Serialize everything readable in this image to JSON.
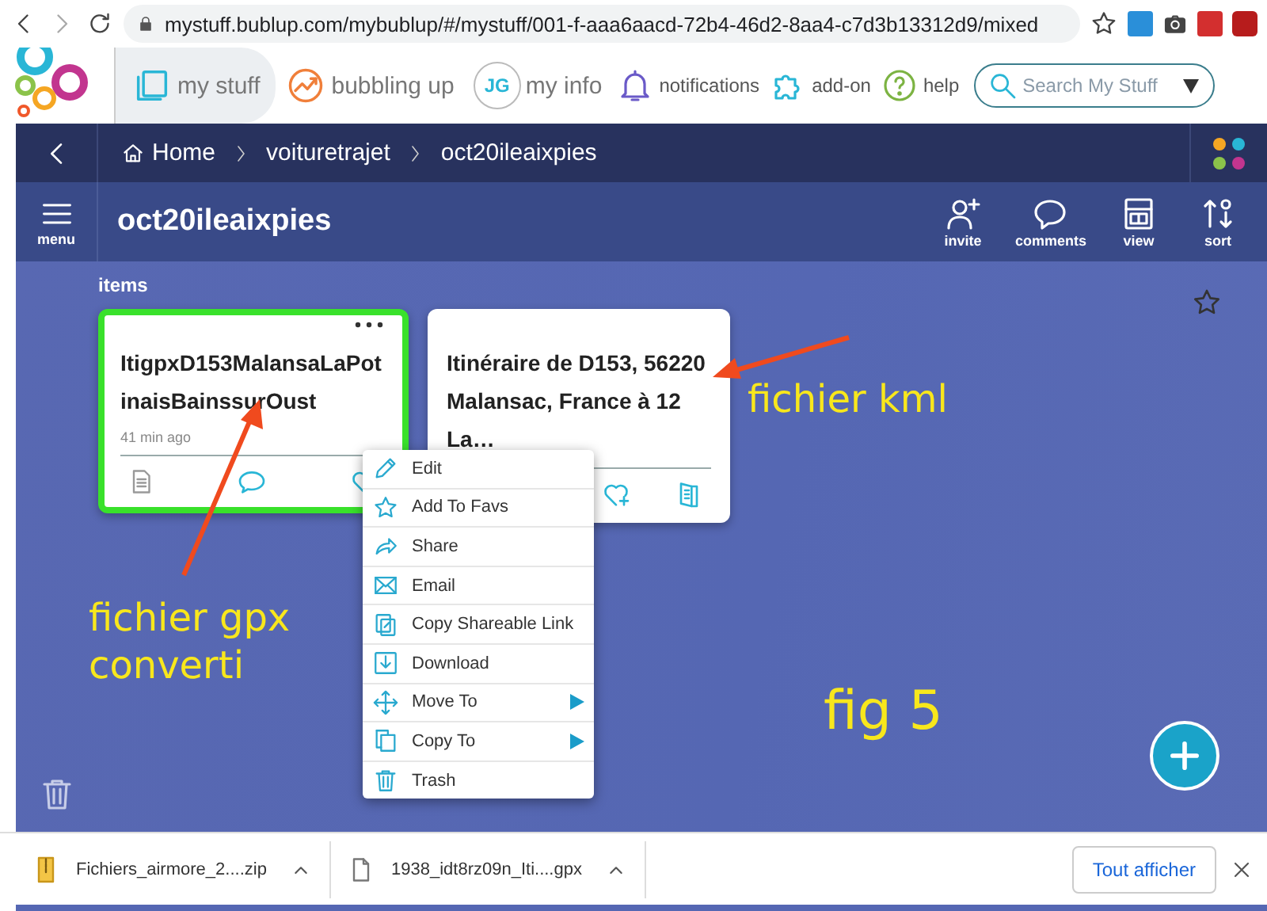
{
  "browser": {
    "url": "mystuff.bublup.com/mybublup/#/mystuff/001-f-aaa6aacd-72b4-46d2-8aa4-c7d3b13312d9/mixed"
  },
  "nav": {
    "tabs": [
      {
        "label": "my stuff",
        "kind": "stuff",
        "selected": true
      },
      {
        "label": "bubbling up",
        "kind": "bubbling",
        "selected": false
      },
      {
        "label": "my info",
        "kind": "info",
        "initials": "JG",
        "selected": false
      },
      {
        "label": "notifications",
        "kind": "bell",
        "selected": false
      },
      {
        "label": "add-on",
        "kind": "puzzle",
        "selected": false
      },
      {
        "label": "help",
        "kind": "help",
        "selected": false
      }
    ],
    "search": {
      "placeholder": "Search My Stuff"
    }
  },
  "breadcrumb": [
    "Home",
    "voituretrajet",
    "oct20ileaixpies"
  ],
  "toolbar": {
    "menu_label": "menu",
    "title": "oct20ileaixpies",
    "actions": [
      {
        "label": "invite",
        "kind": "invite"
      },
      {
        "label": "comments",
        "kind": "comments"
      },
      {
        "label": "view",
        "kind": "view"
      },
      {
        "label": "sort",
        "kind": "sort"
      }
    ]
  },
  "section_label": "items",
  "cards": [
    {
      "title": "ItigpxD153MalansaLaPotinaisBainssurOust",
      "meta": "41 min ago",
      "selected": true
    },
    {
      "title": "Itinéraire de D153, 56220 Malansac, France à 12 La…",
      "selected": false
    }
  ],
  "context_menu": [
    {
      "label": "Edit",
      "kind": "edit",
      "submenu": false
    },
    {
      "label": "Add To Favs",
      "kind": "star",
      "submenu": false
    },
    {
      "label": "Share",
      "kind": "share",
      "submenu": false
    },
    {
      "label": "Email",
      "kind": "email",
      "submenu": false
    },
    {
      "label": "Copy Shareable Link",
      "kind": "link",
      "submenu": false
    },
    {
      "label": "Download",
      "kind": "download",
      "submenu": false
    },
    {
      "label": "Move To",
      "kind": "move",
      "submenu": true
    },
    {
      "label": "Copy To",
      "kind": "copy",
      "submenu": true
    },
    {
      "label": "Trash",
      "kind": "trash",
      "submenu": false
    }
  ],
  "annotations": [
    {
      "text": "fichier kml",
      "kind": "kml"
    },
    {
      "text": "fichier gpx\nconverti",
      "kind": "gpx"
    },
    {
      "text": "fig 5",
      "kind": "fig"
    }
  ],
  "downloads": {
    "files": [
      {
        "name": "Fichiers_airmore_2....zip",
        "kind": "zip"
      },
      {
        "name": "1938_idt8rz09n_Iti....gpx",
        "kind": "file"
      }
    ],
    "show_all": "Tout afficher"
  }
}
